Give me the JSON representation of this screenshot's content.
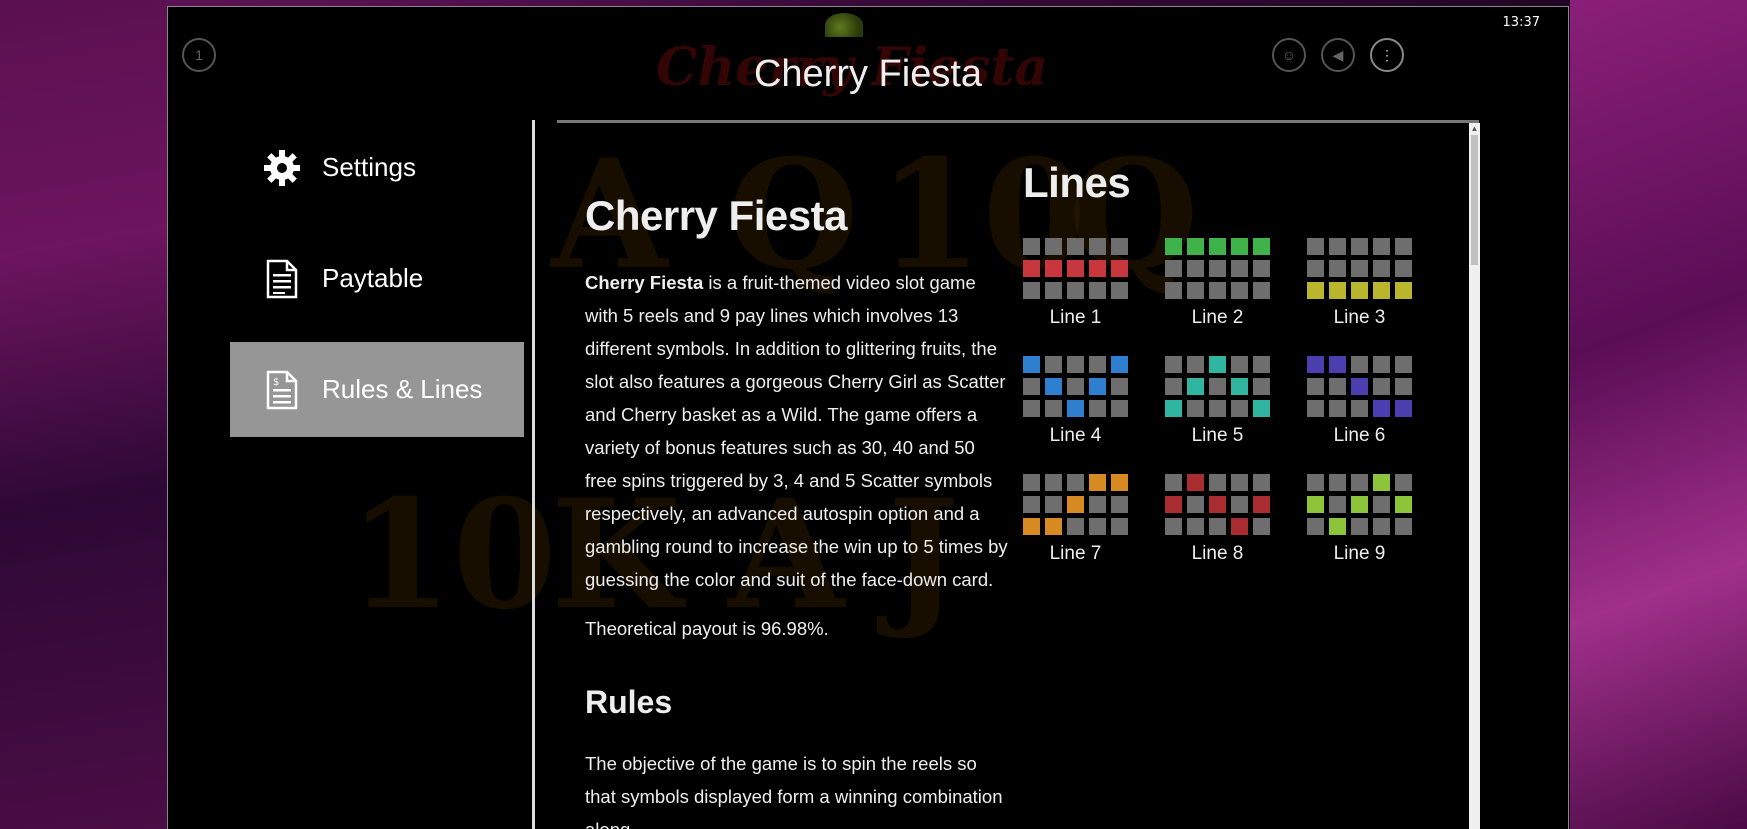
{
  "clock": "13:37",
  "window_title": "Cherry Fiesta",
  "sidebar": {
    "items": [
      {
        "label": "Settings",
        "icon": "gear-icon"
      },
      {
        "label": "Paytable",
        "icon": "document-icon"
      },
      {
        "label": "Rules & Lines",
        "icon": "document-dollar-icon",
        "active": true
      }
    ]
  },
  "content": {
    "heading": "Cherry Fiesta",
    "intro_bold": "Cherry Fiesta",
    "intro_rest": " is a fruit-themed video slot game with 5 reels and 9 pay lines which involves 13 different symbols. In addition to glittering fruits, the slot also features a gorgeous Cherry Girl as Scatter and Cherry basket as a Wild. The game offers a variety of bonus features such as 30, 40 and 50 free spins triggered by 3, 4 and 5 Scatter symbols respectively, an advanced autospin option and a gambling round to increase the win up to 5 times by guessing the color and suit of the face-down card.",
    "payout": "Theoretical payout is 96.98%.",
    "rules_heading": "Rules",
    "rules_text": "The objective of the game is to spin the reels so that symbols displayed form a winning combination along"
  },
  "lines": {
    "title": "Lines",
    "items": [
      {
        "label": "Line 1",
        "color": "#c8373d",
        "rows": [
          1,
          1,
          1,
          1,
          1
        ]
      },
      {
        "label": "Line 2",
        "color": "#3fb34a",
        "rows": [
          0,
          0,
          0,
          0,
          0
        ]
      },
      {
        "label": "Line 3",
        "color": "#b9b52c",
        "rows": [
          2,
          2,
          2,
          2,
          2
        ]
      },
      {
        "label": "Line 4",
        "color": "#2f7fd0",
        "rows": [
          0,
          1,
          2,
          1,
          0
        ]
      },
      {
        "label": "Line 5",
        "color": "#2fb5a0",
        "rows": [
          2,
          1,
          0,
          1,
          2
        ]
      },
      {
        "label": "Line 6",
        "color": "#4b3fb0",
        "rows": [
          0,
          0,
          1,
          2,
          2
        ]
      },
      {
        "label": "Line 7",
        "color": "#d88a22",
        "rows": [
          2,
          2,
          1,
          0,
          0
        ]
      },
      {
        "label": "Line 8",
        "color": "#a82c30",
        "rows": [
          1,
          0,
          1,
          2,
          1
        ]
      },
      {
        "label": "Line 9",
        "color": "#8cc43a",
        "rows": [
          1,
          2,
          1,
          0,
          1
        ]
      }
    ]
  },
  "colors": {
    "cell_inactive": "#6e6e6e",
    "sidebar_active": "#969696"
  }
}
